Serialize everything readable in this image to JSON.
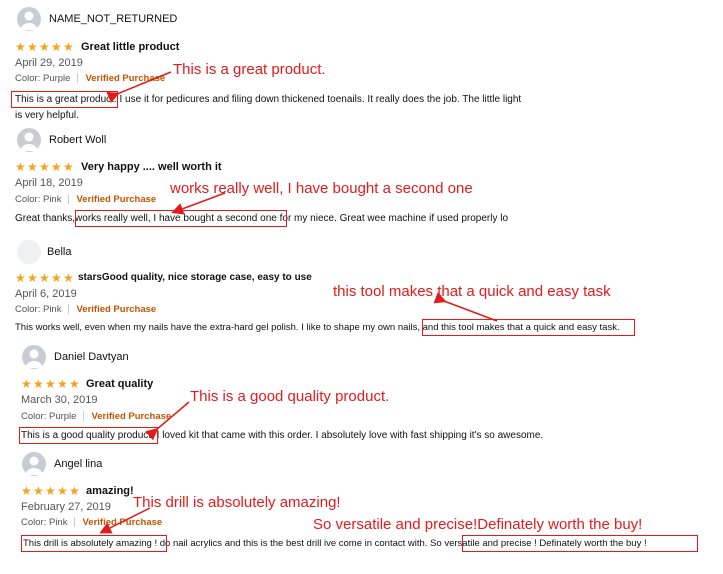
{
  "reviews": [
    {
      "reviewer": "NAME_NOT_RETURNED",
      "rating": 5,
      "title": "Great little product",
      "date": "April 29, 2019",
      "color": "Color: Purple",
      "verified": "Verified Purchase",
      "text_highlight": "This is a great product.",
      "text_rest": " I use it for pedicures and filing down thickened toenails. It really does the job. The little light is very helpful.",
      "annotation": "This is a great product."
    },
    {
      "reviewer": "Robert Woll",
      "rating": 5,
      "title": "Very happy .... well worth it",
      "date": "April 18, 2019",
      "color": "Color: Pink",
      "verified": "Verified Purchase",
      "text_before": "Great thanks,",
      "text_highlight": "works really well, I have bought a second one",
      "text_rest": " for my niece. Great wee machine if used properly lo",
      "annotation": "works really well, I have bought a  second one"
    },
    {
      "reviewer": "Bella",
      "rating": 5,
      "title": "starsGood quality, nice storage case, easy to use",
      "date": "April 6, 2019",
      "color": "Color: Pink",
      "verified": "Verified Purchase",
      "text_before": "This works well, even when my nails have the extra-hard gel polish. I like to shape my own nails",
      "text_highlight": ", and this tool makes that a quick and easy task.",
      "annotation": "this tool makes that a quick and easy task"
    },
    {
      "reviewer": "Daniel Davtyan",
      "rating": 5,
      "title": "Great quality",
      "date": "March 30, 2019",
      "color": "Color: Purple",
      "verified": "Verified Purchase",
      "text_highlight": "This is a good quality product.",
      "text_rest": " I loved kit that came with this order. I absolutely love with fast shipping it's so awesome.",
      "annotation": "This is a good quality product."
    },
    {
      "reviewer": "Angel lina",
      "rating": 5,
      "title": "amazing!",
      "date": "February 27, 2019",
      "color": "Color: Pink",
      "verified": "Verified Purchase",
      "text_highlight": "This drill is absolutely amazing !",
      "text_middle": " do nail acrylics and this is the best drill ive come in contact with.",
      "text_highlight2": "So versatile and precise ! Definately worth the buy !",
      "annotation": "This drill is absolutely amazing!",
      "annotation2": "So versatile and precise!Definately worth the buy!"
    }
  ],
  "colors": {
    "annotation": "#e31b1b",
    "star": "#f4a31c",
    "verified": "#c45500"
  }
}
